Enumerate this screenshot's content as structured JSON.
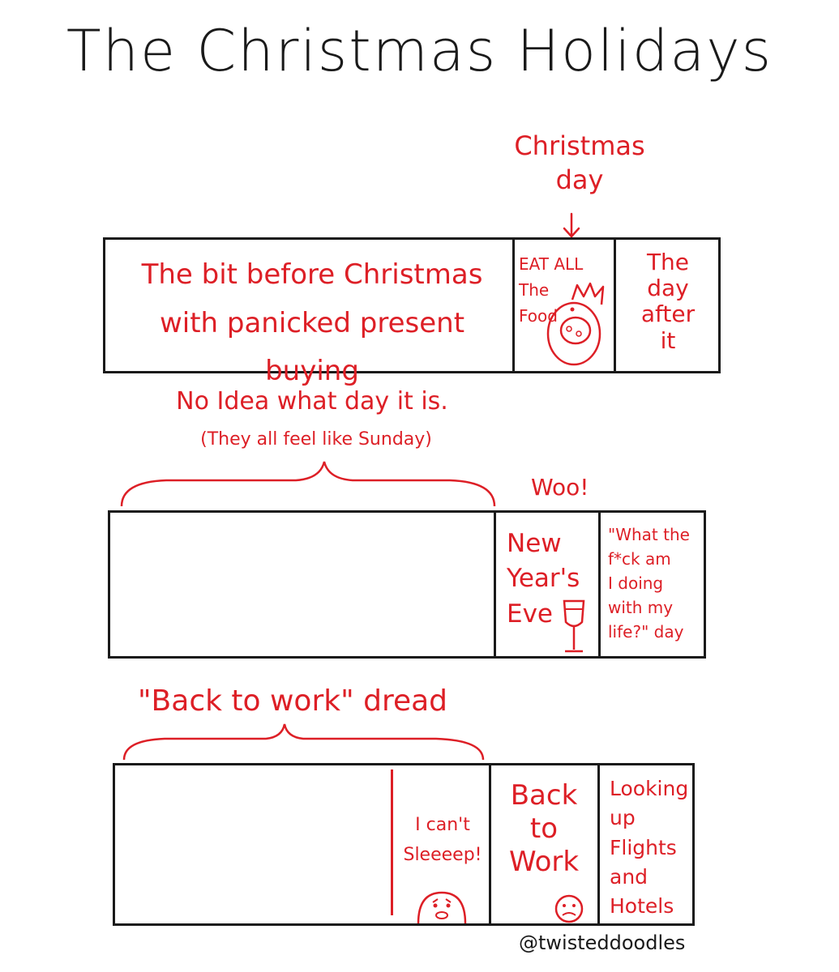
{
  "title": "The Christmas Holidays",
  "row1": {
    "christmas_day_label": "Christmas\nday",
    "panel_a": "The bit before Christmas\nwith panicked present buying",
    "panel_b": "EAT ALL\nThe\nFood",
    "panel_c": "The\nday\nafter\nit"
  },
  "row2": {
    "brace_label_main": "No Idea what day it is.",
    "brace_label_sub": "(They all feel like Sunday)",
    "woo_label": "Woo!",
    "panel_b": "New\nYear's\nEve",
    "panel_c": "\"What the\nf*ck am\nI doing\nwith my\nlife?\" day"
  },
  "row3": {
    "brace_label": "\"Back to work\" dread",
    "cant_sleep": "I can't\nSleeeep!",
    "panel_b": "Back\nto\nWork",
    "panel_c": "Looking\nup Flights\nand\nHotels"
  },
  "credit": "@twisteddoodles",
  "colors": {
    "ink": "#1a1a1a",
    "red": "#dd1f26"
  }
}
